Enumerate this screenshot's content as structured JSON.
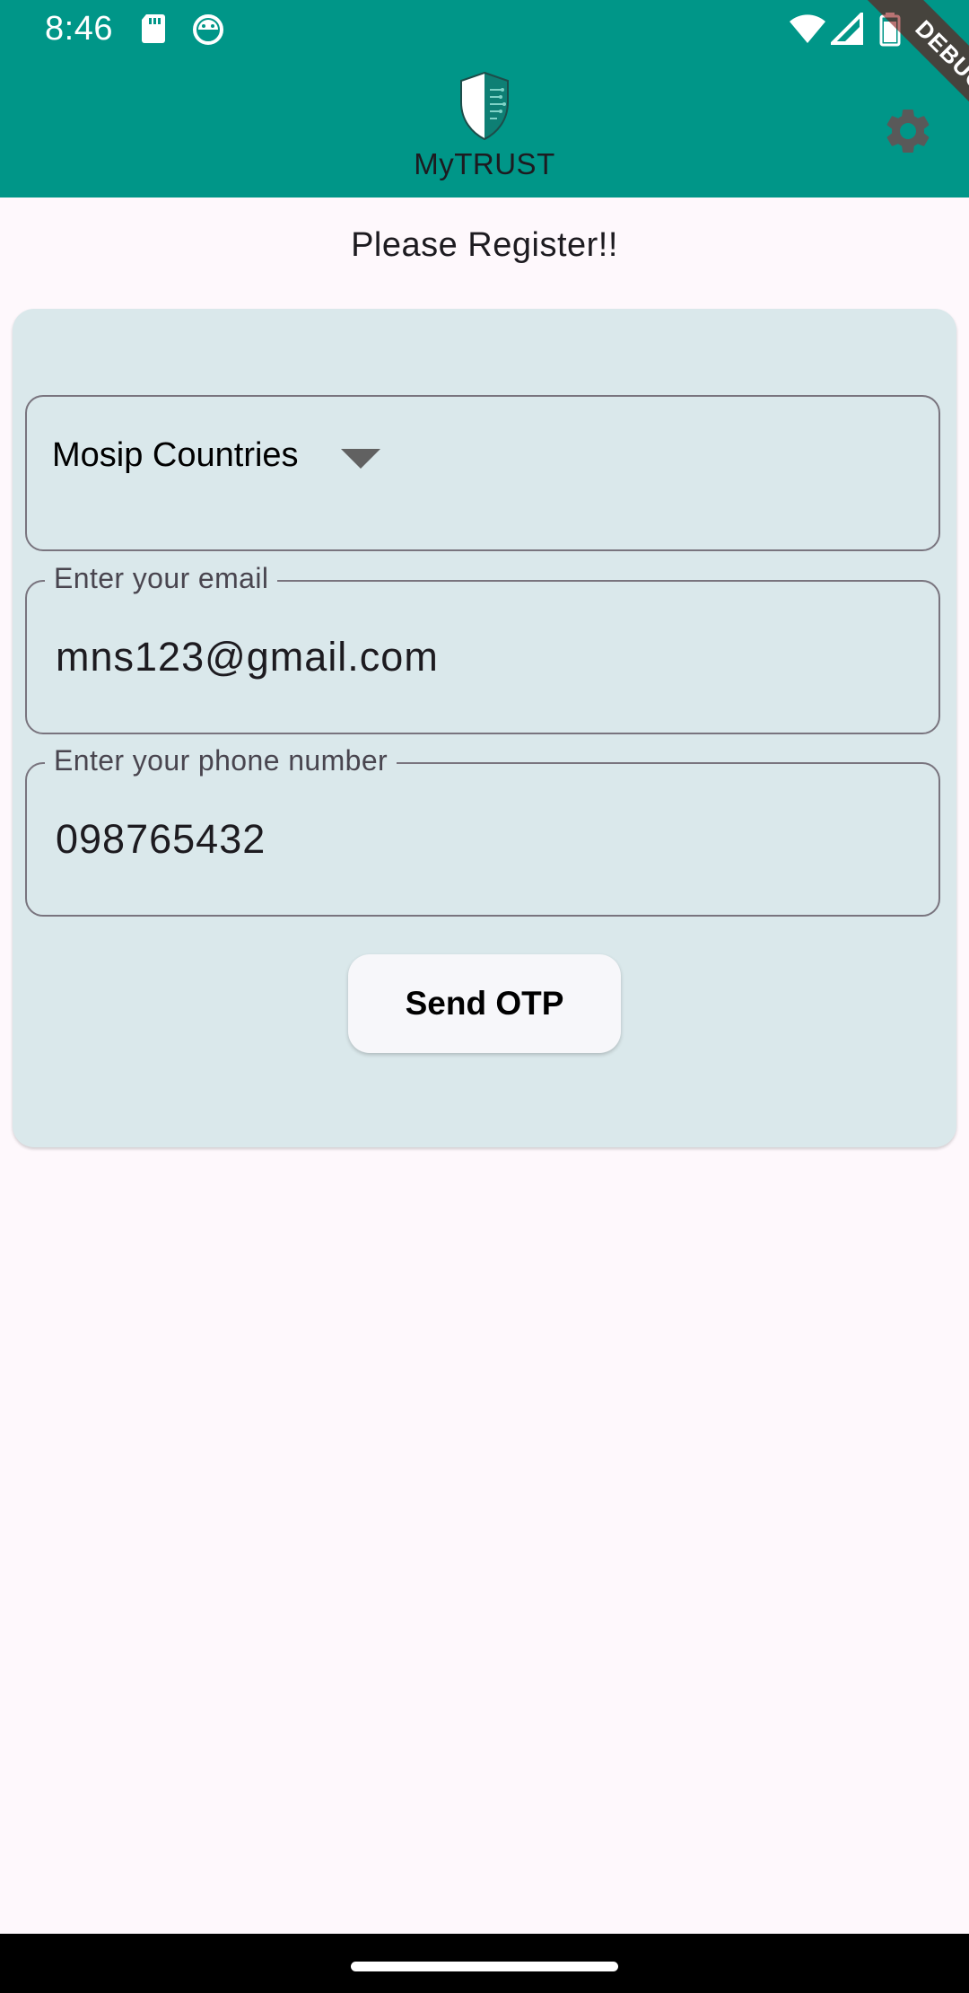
{
  "status_bar": {
    "time": "8:46",
    "icons": [
      "sd-card-icon",
      "android-debug-icon",
      "wifi-icon",
      "signal-icon",
      "battery-icon"
    ]
  },
  "app_bar": {
    "logo_text": "MyTRUST",
    "logo_icon": "shield-icon",
    "settings_icon": "gear-icon",
    "debug_banner": "DEBUG",
    "color": "#009688"
  },
  "page": {
    "heading": "Please Register!!"
  },
  "form": {
    "country_dropdown": {
      "selected": "Mosip Countries"
    },
    "email": {
      "label": "Enter your email",
      "value": "mns123@gmail.com"
    },
    "phone": {
      "label": "Enter your phone number",
      "value": "098765432"
    },
    "submit_label": "Send OTP"
  },
  "colors": {
    "card_bg": "#dae8eb",
    "page_bg": "#fef8fc",
    "accent": "#009688"
  }
}
